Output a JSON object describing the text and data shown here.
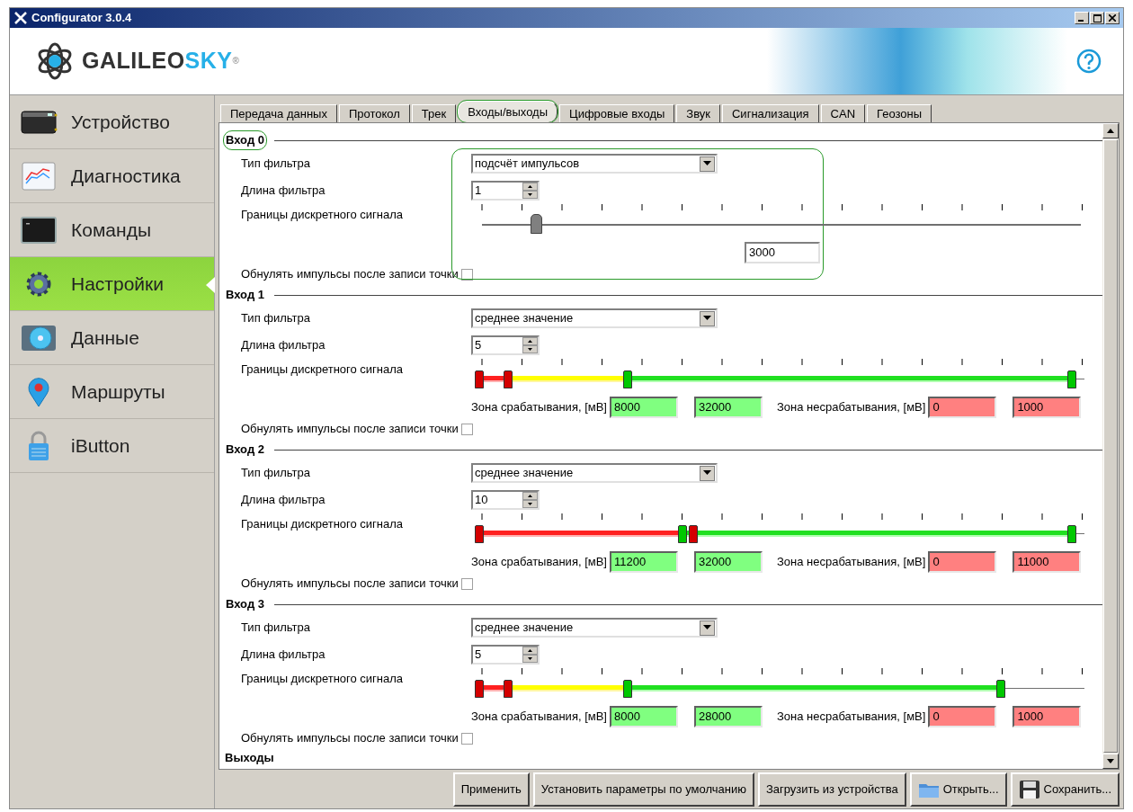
{
  "window": {
    "title": "Configurator 3.0.4"
  },
  "header": {
    "logo": "GALILEO",
    "logo_accent": "SKY",
    "registered": "®"
  },
  "sidebar": {
    "items": [
      {
        "label": "Устройство",
        "kind": "device",
        "selected": false
      },
      {
        "label": "Диагностика",
        "kind": "chart",
        "selected": false
      },
      {
        "label": "Команды",
        "kind": "terminal",
        "selected": false
      },
      {
        "label": "Настройки",
        "kind": "gear",
        "selected": true
      },
      {
        "label": "Данные",
        "kind": "disc",
        "selected": false
      },
      {
        "label": "Маршруты",
        "kind": "pin",
        "selected": false
      },
      {
        "label": "iButton",
        "kind": "lock",
        "selected": false
      }
    ]
  },
  "tabs": [
    {
      "label": "Передача данных",
      "selected": false,
      "highlighted": false
    },
    {
      "label": "Протокол",
      "selected": false,
      "highlighted": false
    },
    {
      "label": "Трек",
      "selected": false,
      "highlighted": false
    },
    {
      "label": "Входы/выходы",
      "selected": true,
      "highlighted": true
    },
    {
      "label": "Цифровые входы",
      "selected": false,
      "highlighted": false
    },
    {
      "label": "Звук",
      "selected": false,
      "highlighted": false
    },
    {
      "label": "Сигнализация",
      "selected": false,
      "highlighted": false
    },
    {
      "label": "CAN",
      "selected": false,
      "highlighted": false
    },
    {
      "label": "Геозоны",
      "selected": false,
      "highlighted": false
    }
  ],
  "sections": [
    {
      "kind": "counter",
      "title": "Вход 0",
      "title_highlighted": true,
      "settings_highlighted": true,
      "filter_type_label": "Тип фильтра",
      "filter_type": "подсчёт импульсов",
      "filter_length_label": "Длина фильтра",
      "filter_length": "1",
      "bounds_label": "Границы дискретного сигнала",
      "level": 0.09,
      "value": "3000",
      "reset_label": "Обнулять импульсы после записи точки",
      "reset_checked": false
    },
    {
      "kind": "range",
      "title": "Вход 1",
      "title_highlighted": false,
      "settings_highlighted": false,
      "filter_type_label": "Тип фильтра",
      "filter_type": "среднее значение",
      "filter_length_label": "Длина фильтра",
      "filter_length": "5",
      "bounds_label": "Границы дискретного сигнала",
      "thumbs": [
        {
          "level": 0.008,
          "color": "#d40000"
        },
        {
          "level": 0.055,
          "color": "#d40000"
        },
        {
          "level": 0.25,
          "color": "#00c800"
        },
        {
          "level": 0.98,
          "color": "#00c800"
        }
      ],
      "trigger_label": "Зона срабатывания, [мВ]",
      "trigger_from": "8000",
      "trigger_to": "32000",
      "idle_label": "Зона несрабатывания, [мВ]",
      "idle_from": "0",
      "idle_to": "1000",
      "reset_label": "Обнулять импульсы после записи точки",
      "reset_checked": false
    },
    {
      "kind": "range",
      "title": "Вход 2",
      "title_highlighted": false,
      "settings_highlighted": false,
      "filter_type_label": "Тип фильтра",
      "filter_type": "среднее значение",
      "filter_length_label": "Длина фильтра",
      "filter_length": "10",
      "bounds_label": "Границы дискретного сигнала",
      "thumbs": [
        {
          "level": 0.008,
          "color": "#d40000"
        },
        {
          "level": 0.358,
          "color": "#d40000"
        },
        {
          "level": 0.34,
          "color": "#00c800"
        },
        {
          "level": 0.98,
          "color": "#00c800"
        }
      ],
      "trigger_label": "Зона срабатывания, [мВ]",
      "trigger_from": "11200",
      "trigger_to": "32000",
      "idle_label": "Зона несрабатывания, [мВ]",
      "idle_from": "0",
      "idle_to": "11000",
      "reset_label": "Обнулять импульсы после записи точки",
      "reset_checked": false
    },
    {
      "kind": "range",
      "title": "Вход 3",
      "title_highlighted": false,
      "settings_highlighted": false,
      "filter_type_label": "Тип фильтра",
      "filter_type": "среднее значение",
      "filter_length_label": "Длина фильтра",
      "filter_length": "5",
      "bounds_label": "Границы дискретного сигнала",
      "thumbs": [
        {
          "level": 0.008,
          "color": "#d40000"
        },
        {
          "level": 0.055,
          "color": "#d40000"
        },
        {
          "level": 0.25,
          "color": "#00c800"
        },
        {
          "level": 0.863,
          "color": "#00c800"
        }
      ],
      "trigger_label": "Зона срабатывания, [мВ]",
      "trigger_from": "8000",
      "trigger_to": "28000",
      "idle_label": "Зона несрабатывания, [мВ]",
      "idle_from": "0",
      "idle_to": "1000",
      "reset_label": "Обнулять импульсы после записи точки",
      "reset_checked": false
    }
  ],
  "next_section": "Выходы",
  "buttons": [
    {
      "label": "Применить"
    },
    {
      "label": "Установить параметры по умолчанию"
    },
    {
      "label": "Загрузить из устройства"
    },
    {
      "label": "Открыть..."
    },
    {
      "label": "Сохранить..."
    }
  ]
}
